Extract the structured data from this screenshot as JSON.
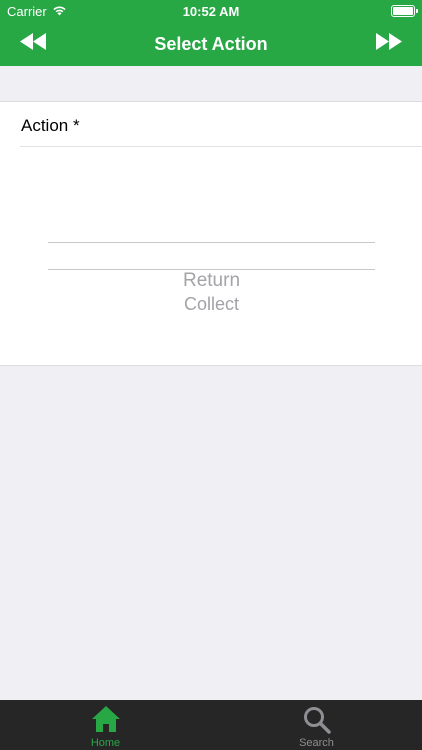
{
  "status_bar": {
    "carrier": "Carrier",
    "time": "10:52 AM",
    "battery_level": 1.0
  },
  "nav_bar": {
    "title": "Select Action",
    "left_icon": "rewind-icon",
    "right_icon": "fast-forward-icon"
  },
  "form": {
    "action_label": "Action *",
    "picker_options": [
      "Return",
      "Collect"
    ]
  },
  "tab_bar": {
    "items": [
      {
        "label": "Home",
        "icon": "home-icon",
        "active": true
      },
      {
        "label": "Search",
        "icon": "search-icon",
        "active": false
      }
    ]
  },
  "colors": {
    "primary": "#28a745",
    "tab_bar_bg": "#262626",
    "page_bg": "#efeff4",
    "picker_text": "#a3a3a8"
  }
}
